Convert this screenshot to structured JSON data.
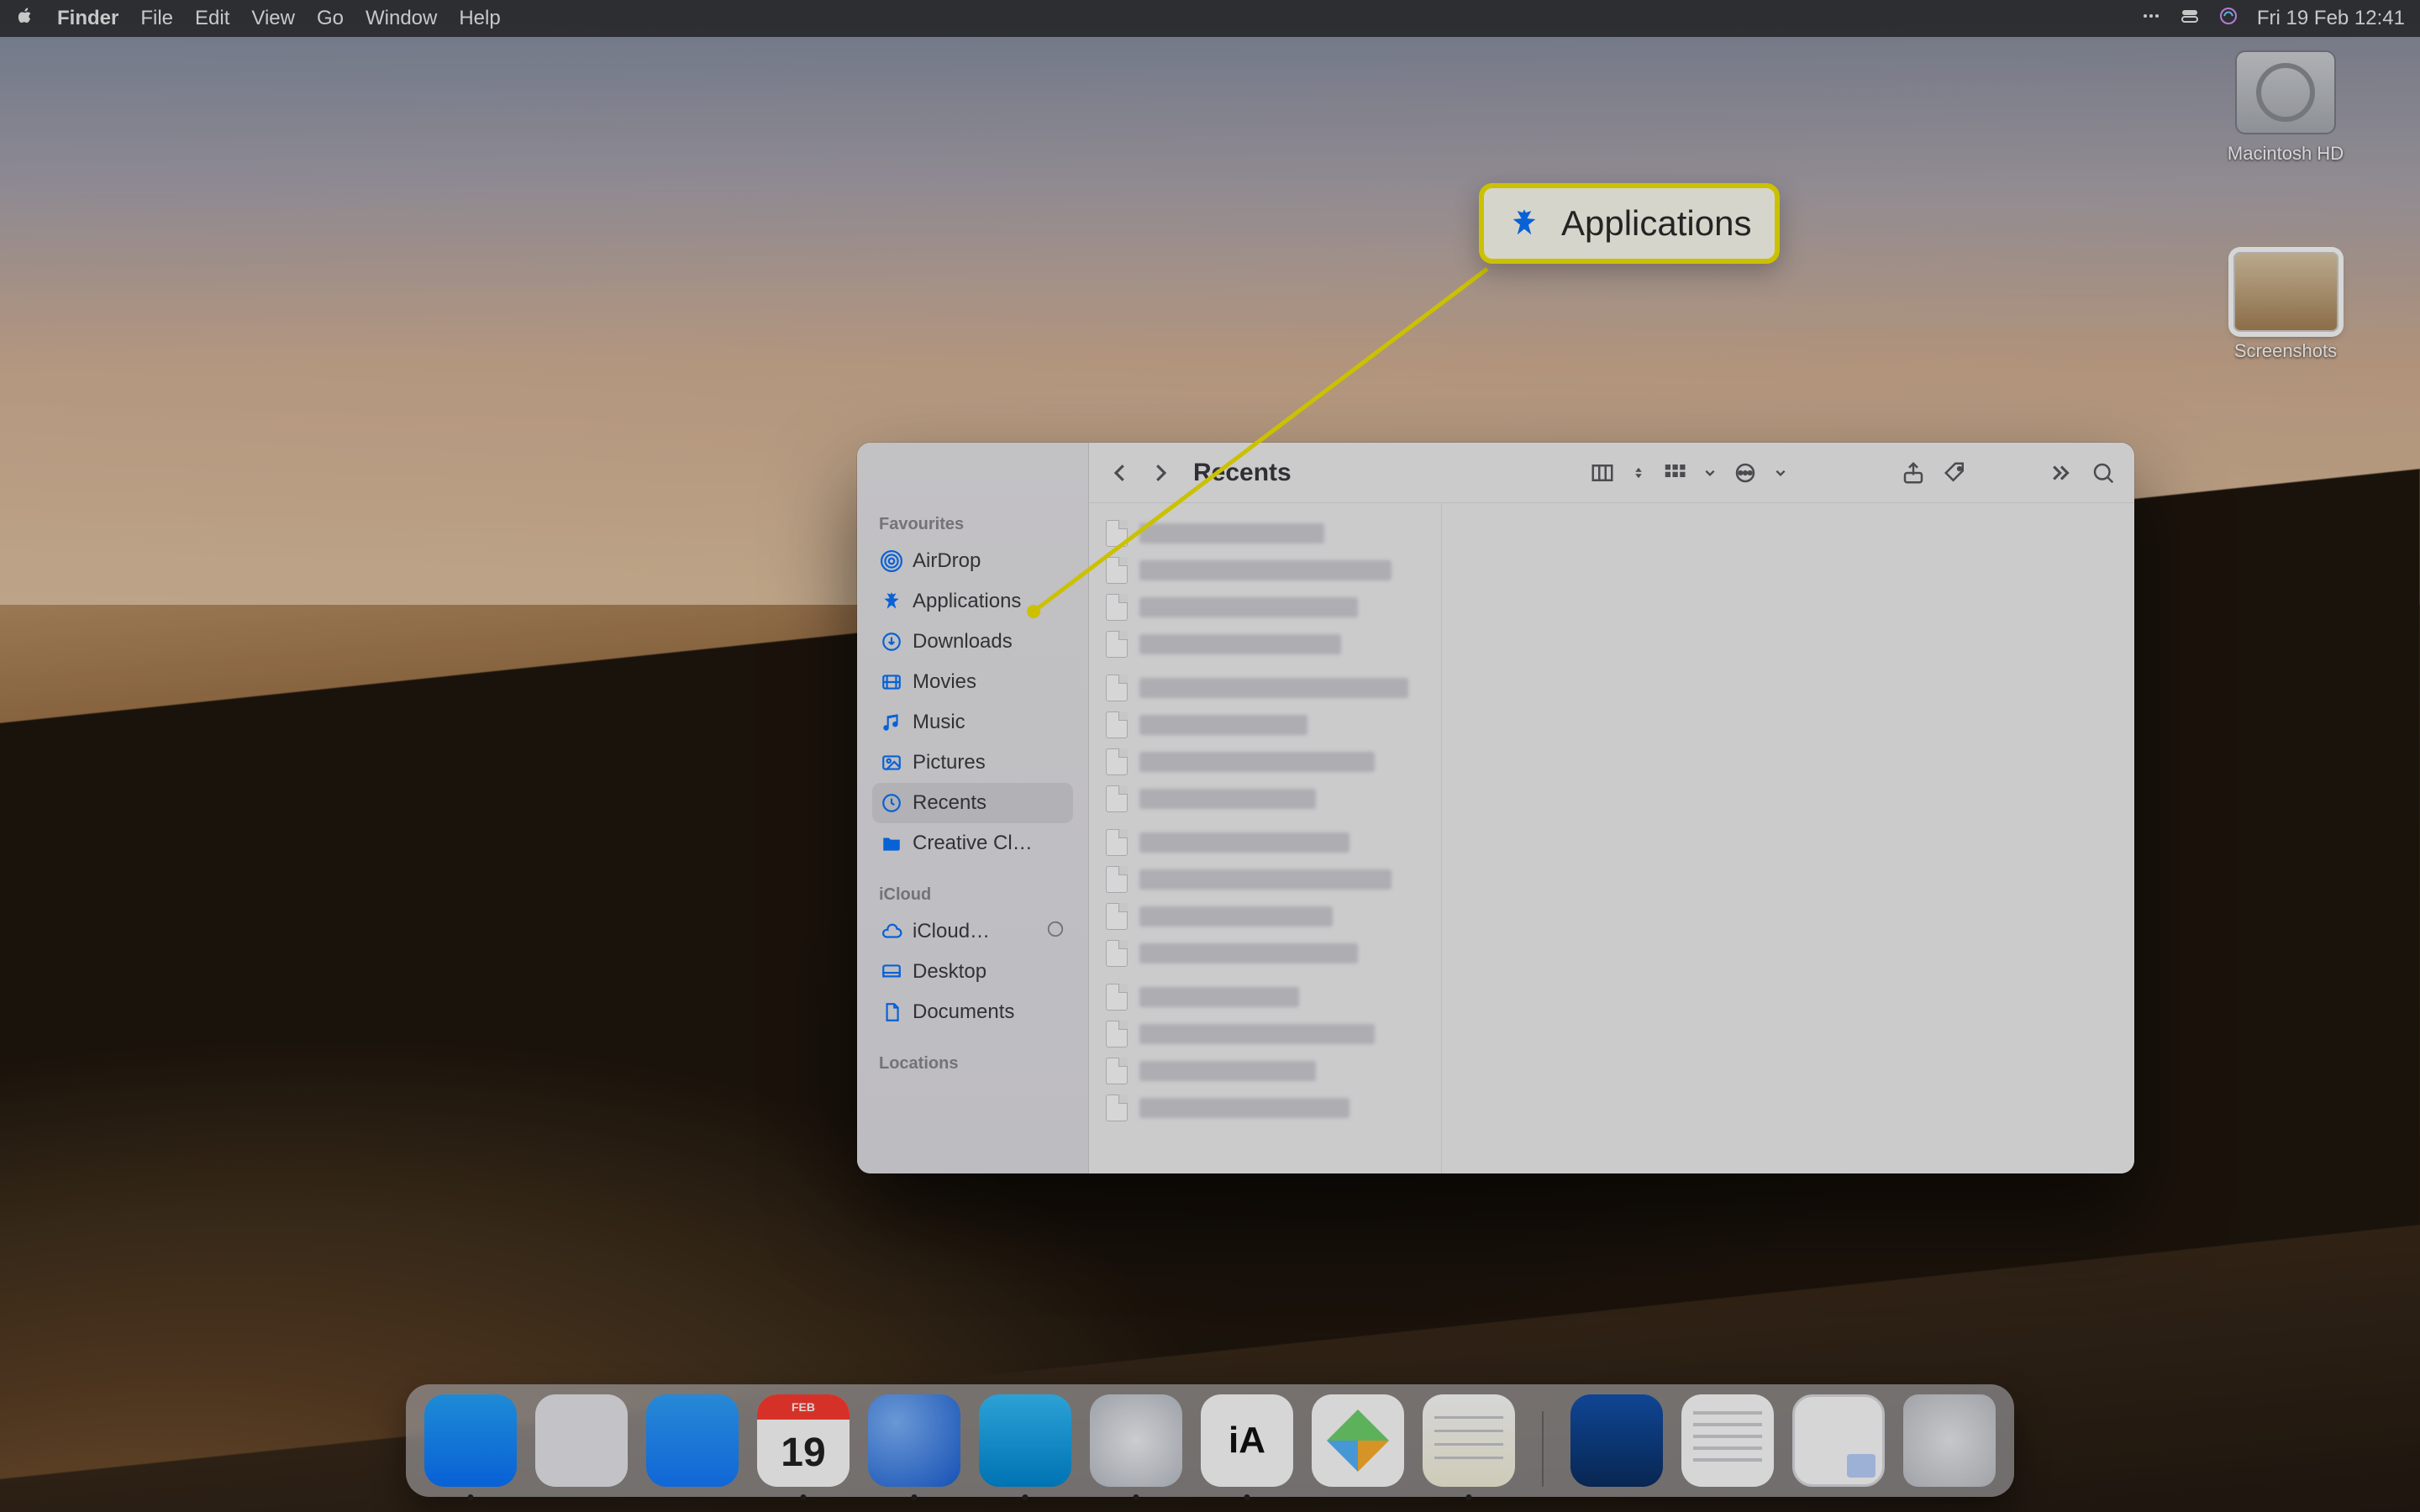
{
  "menubar": {
    "app": "Finder",
    "menus": [
      "File",
      "Edit",
      "View",
      "Go",
      "Window",
      "Help"
    ],
    "datetime": "Fri 19 Feb  12:41"
  },
  "desktop_icons": {
    "hdd": "Macintosh HD",
    "screenshots": "Screenshots"
  },
  "callout": {
    "label": "Applications"
  },
  "finder": {
    "title": "Recents",
    "sidebar": {
      "sections": {
        "favourites": "Favourites",
        "icloud": "iCloud",
        "locations": "Locations"
      },
      "favourites": [
        {
          "icon": "airdrop-icon",
          "label": "AirDrop"
        },
        {
          "icon": "appstore-icon",
          "label": "Applications"
        },
        {
          "icon": "download-icon",
          "label": "Downloads"
        },
        {
          "icon": "movies-icon",
          "label": "Movies"
        },
        {
          "icon": "music-icon",
          "label": "Music"
        },
        {
          "icon": "pictures-icon",
          "label": "Pictures"
        },
        {
          "icon": "recents-icon",
          "label": "Recents"
        },
        {
          "icon": "folder-icon",
          "label": "Creative Cl…"
        }
      ],
      "icloud": [
        {
          "icon": "icloud-icon",
          "label": "iCloud…",
          "trailing": "progress"
        },
        {
          "icon": "desktop-icon",
          "label": "Desktop"
        },
        {
          "icon": "document-icon",
          "label": "Documents"
        }
      ]
    },
    "file_count": 16
  },
  "dock": {
    "apps": [
      {
        "name": "finder",
        "running": true
      },
      {
        "name": "launchpad",
        "running": false
      },
      {
        "name": "appstore",
        "running": false
      },
      {
        "name": "calendar",
        "running": true,
        "month": "FEB",
        "day": "19"
      },
      {
        "name": "thunderbird",
        "running": true
      },
      {
        "name": "tweetbot",
        "running": true
      },
      {
        "name": "safari",
        "running": true
      },
      {
        "name": "iawriter",
        "running": true,
        "badge": "iA"
      },
      {
        "name": "kodi",
        "running": false
      },
      {
        "name": "textedit",
        "running": true
      }
    ],
    "stacks": [
      {
        "name": "stack-screenshots"
      },
      {
        "name": "stack-textfiles"
      },
      {
        "name": "stack-documents"
      }
    ],
    "trash": "Trash"
  }
}
